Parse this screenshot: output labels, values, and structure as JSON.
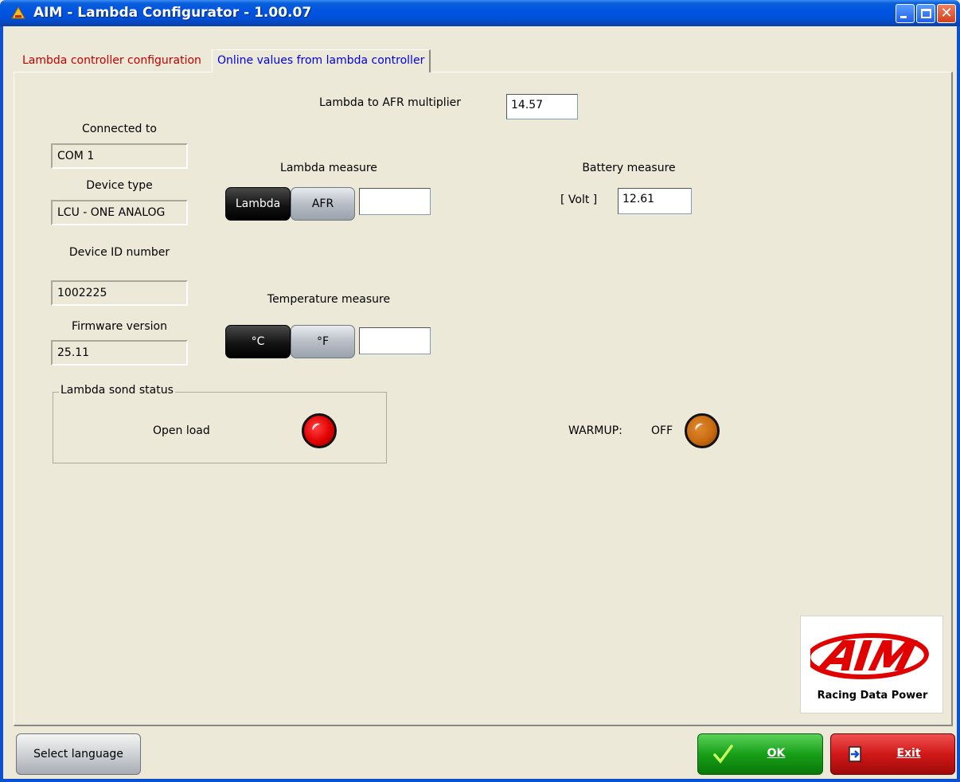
{
  "window": {
    "title": "AIM - Lambda Configurator - 1.00.07",
    "minimize_glyph": "",
    "maximize_glyph": "",
    "close_glyph": "✕"
  },
  "tabs": [
    {
      "label": "Lambda controller configuration",
      "active": false
    },
    {
      "label": "Online values from lambda controller",
      "active": true
    }
  ],
  "device": {
    "connected_label": "Connected to",
    "connected_value": "COM 1",
    "type_label": "Device type",
    "type_value": "LCU - ONE ANALOG",
    "id_label": "Device ID number",
    "id_value": "1002225",
    "firmware_label": "Firmware version",
    "firmware_value": "25.11"
  },
  "afr_multiplier": {
    "label": "Lambda to AFR multiplier",
    "value": "14.57"
  },
  "lambda_measure": {
    "title": "Lambda measure",
    "options": [
      "Lambda",
      "AFR"
    ],
    "selected": "Lambda",
    "value": ""
  },
  "temperature_measure": {
    "title": "Temperature measure",
    "options": [
      "°C",
      "°F"
    ],
    "selected": "°C",
    "value": ""
  },
  "battery_measure": {
    "title": "Battery measure",
    "unit_label": "[ Volt ]",
    "value": "12.61"
  },
  "sond_status": {
    "title": "Lambda sond status",
    "text": "Open load",
    "led_color": "#e00000"
  },
  "warmup": {
    "label": "WARMUP:",
    "state": "OFF",
    "led_color": "#c86a10"
  },
  "logo": {
    "brand": "AiM",
    "tagline": "Racing Data Power"
  },
  "buttons": {
    "language": "Select language",
    "ok": "OK",
    "exit": "Exit"
  }
}
